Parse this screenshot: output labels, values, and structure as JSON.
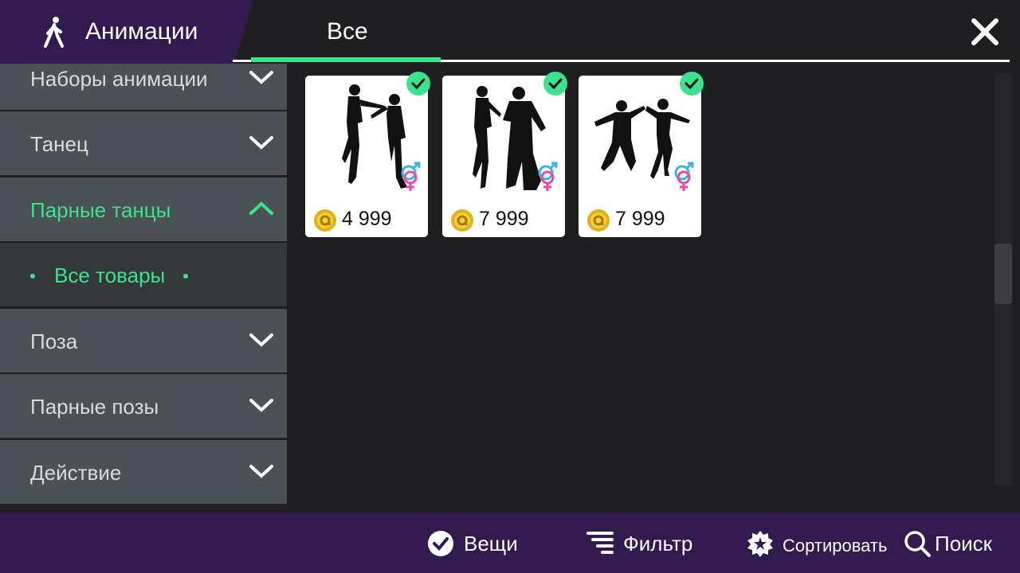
{
  "header": {
    "title": "Анимации",
    "title_icon": "walking-person-icon",
    "tab_label": "Все",
    "close_icon": "close-icon",
    "accent_color": "#3be38e"
  },
  "sidebar": {
    "items": [
      {
        "label": "Наборы анимации",
        "expanded": false
      },
      {
        "label": "Танец",
        "expanded": false
      },
      {
        "label": "Парные танцы",
        "expanded": true,
        "active": true
      },
      {
        "label": "Поза",
        "expanded": false
      },
      {
        "label": "Парные позы",
        "expanded": false
      },
      {
        "label": "Действие",
        "expanded": false
      }
    ],
    "subitem": {
      "label": "Все товары",
      "active": true
    }
  },
  "products": [
    {
      "price": "4 999",
      "owned": true,
      "icon": "couple-dance-silhouette-icon"
    },
    {
      "price": "7 999",
      "owned": true,
      "icon": "couple-dance-silhouette-icon"
    },
    {
      "price": "7 999",
      "owned": true,
      "icon": "couple-dance-silhouette-icon"
    }
  ],
  "bottombar": {
    "items": "items",
    "items_label": "Вещи",
    "filter_label": "Фильтр",
    "sort_label": "Сортировать",
    "search_label": "Поиск"
  }
}
